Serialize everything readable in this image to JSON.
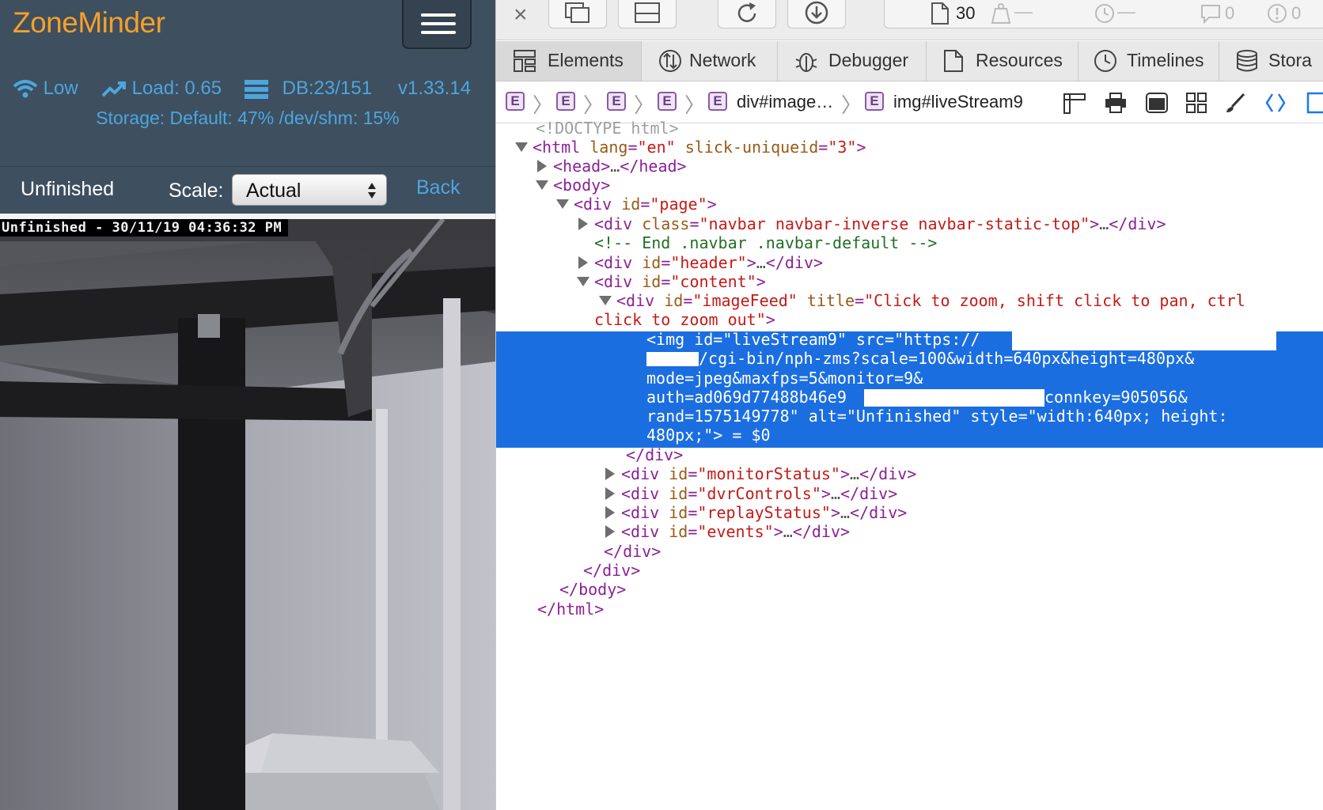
{
  "zoneminder": {
    "brand": "ZoneMinder",
    "bandwidth": "Low",
    "load": "Load: 0.65",
    "db": "DB:23/151",
    "version": "v1.33.14",
    "storage": "Storage: Default: 47% /dev/shm: 15%",
    "monitor_name": "Unfinished",
    "scale_label": "Scale:",
    "scale_value": "Actual",
    "back_label": "Back",
    "timestamp": "Unfinished - 30/11/19 04:36:32 PM",
    "accent_color": "#f5a02a",
    "link_color": "#4ca6df"
  },
  "inspector": {
    "toolbar": {
      "resource_count": "30",
      "errors": "0",
      "warnings": "0"
    },
    "tabs": [
      {
        "label": "Elements"
      },
      {
        "label": "Network"
      },
      {
        "label": "Debugger"
      },
      {
        "label": "Resources"
      },
      {
        "label": "Timelines"
      },
      {
        "label": "Stora"
      }
    ],
    "breadcrumbs": {
      "crumb_icon": "E",
      "crumb5": "div#image…",
      "crumb6": "img#liveStream9"
    },
    "dom": {
      "doctype": "<!DOCTYPE html>",
      "html_lang": "\"en\"",
      "html_uid": "\"3\"",
      "ellipsis": "…",
      "navbar_class": "\"navbar navbar-inverse navbar-static-top\"",
      "comment": "<!-- End .navbar .navbar-default -->",
      "header_id": "\"header\"",
      "content_id": "\"content\"",
      "page_id": "\"page\"",
      "imagefeed_id": "\"imageFeed\"",
      "imagefeed_title1": "\"Click to zoom, shift click to pan, ctrl",
      "imagefeed_title2": "click to zoom out\"",
      "img_line1": "<img id=\"liveStream9\" src=\"https://",
      "img_line2": "/cgi-bin/nph-zms?scale=100&width=640px&height=480px&",
      "img_line3": "mode=jpeg&maxfps=5&monitor=9&",
      "img_line4a": "auth=ad069d77488b46e9",
      "img_line4b": "connkey=905056&",
      "img_line5": "rand=1575149778\" alt=\"Unfinished\" style=\"width:640px; height:",
      "img_line6": "480px;\"> = $0",
      "monitor_status_id": "\"monitorStatus\"",
      "dvr_controls_id": "\"dvrControls\"",
      "replay_status_id": "\"replayStatus\"",
      "events_id": "\"events\""
    }
  }
}
